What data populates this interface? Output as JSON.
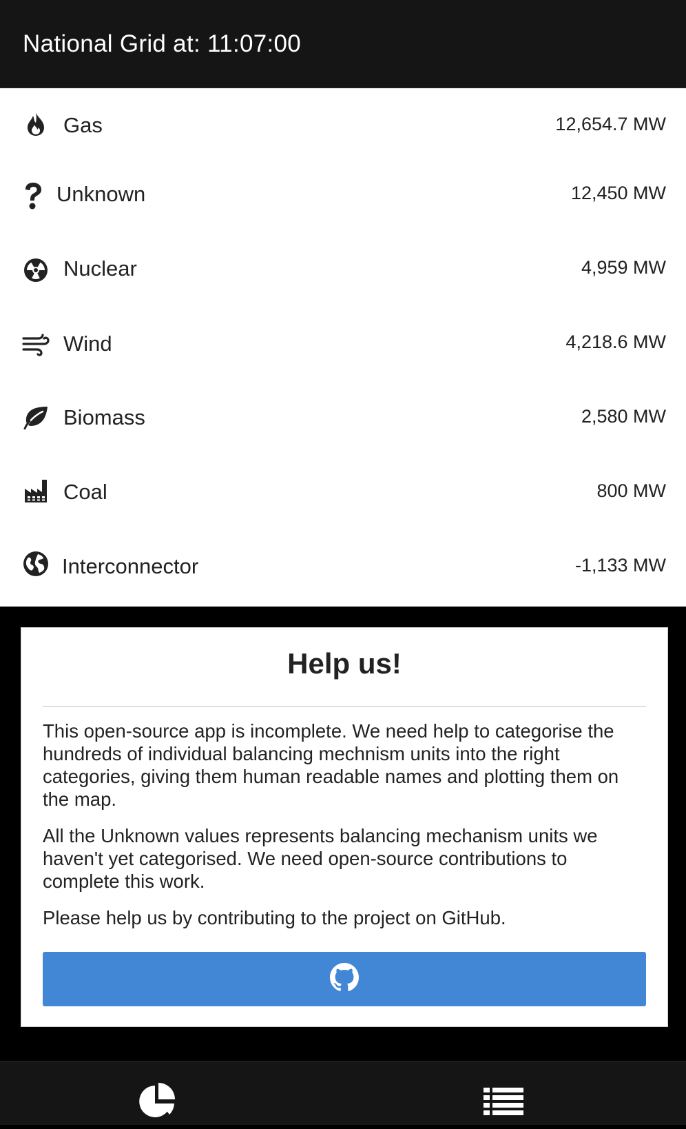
{
  "header": {
    "title": "National Grid at: 11:07:00"
  },
  "sources": [
    {
      "icon": "flame-icon",
      "label": "Gas",
      "value": "12,654.7 MW"
    },
    {
      "icon": "question-icon",
      "label": "Unknown",
      "value": "12,450 MW"
    },
    {
      "icon": "radiation-icon",
      "label": "Nuclear",
      "value": "4,959 MW"
    },
    {
      "icon": "wind-icon",
      "label": "Wind",
      "value": "4,218.6 MW"
    },
    {
      "icon": "leaf-icon",
      "label": "Biomass",
      "value": "2,580 MW"
    },
    {
      "icon": "factory-icon",
      "label": "Coal",
      "value": "800 MW"
    },
    {
      "icon": "globe-icon",
      "label": "Interconnector",
      "value": "-1,133 MW"
    }
  ],
  "help": {
    "title": "Help us!",
    "paragraphs": [
      "This open-source app is incomplete. We need help to categorise the hundreds of individual balancing mechnism units into the right categories, giving them human readable names and plotting them on the map.",
      "All the Unknown values represents balancing mechanism units we haven't yet categorised. We need open-source contributions to complete this work.",
      "Please help us by contributing to the project on GitHub."
    ],
    "button_icon": "github-icon",
    "button_color": "#4286d6"
  },
  "bottom_nav": {
    "items": [
      {
        "icon": "pie-chart-icon"
      },
      {
        "icon": "list-icon"
      }
    ]
  }
}
